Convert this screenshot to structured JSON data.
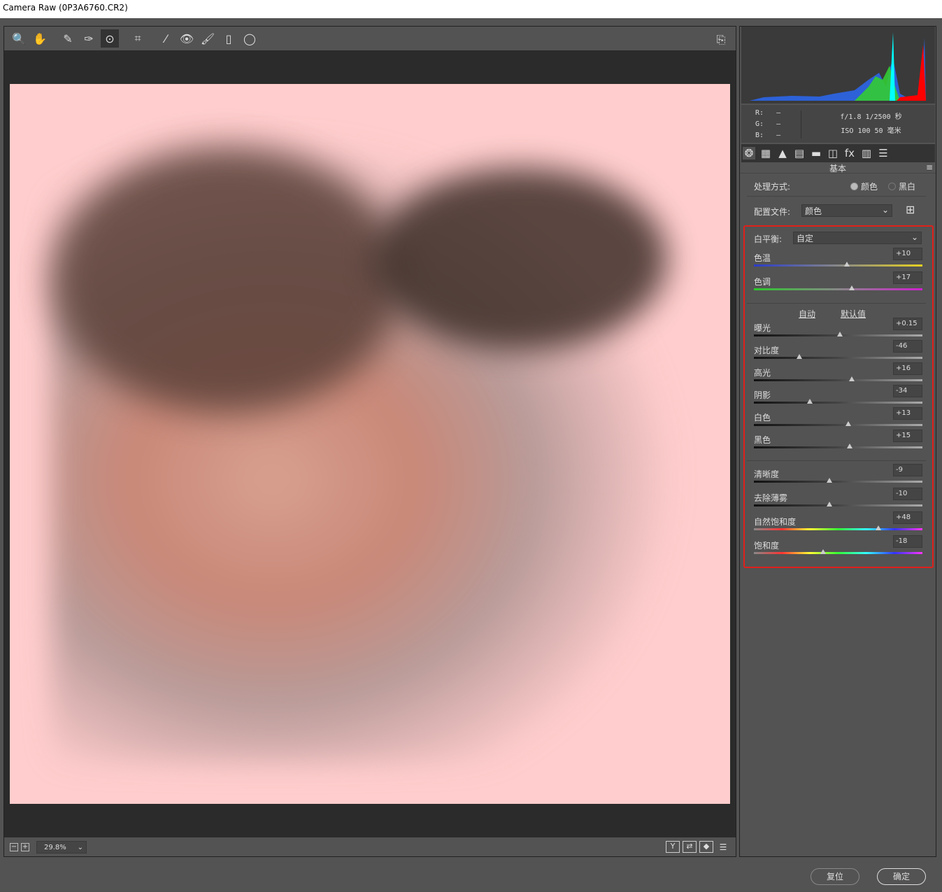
{
  "window": {
    "title": "Camera Raw (0P3A6760.CR2)"
  },
  "toolbar": {
    "tools": [
      {
        "name": "zoom-tool-icon",
        "glyph": "🔍"
      },
      {
        "name": "hand-tool-icon",
        "glyph": "✋"
      },
      {
        "name": "white-balance-tool-icon",
        "glyph": "✎"
      },
      {
        "name": "color-sampler-tool-icon",
        "glyph": "✑"
      },
      {
        "name": "targeted-adjustment-tool-icon",
        "glyph": "⊙",
        "active": true
      },
      {
        "name": "transform-tool-icon",
        "glyph": "⌗"
      },
      {
        "name": "spot-removal-tool-icon",
        "glyph": "⁄"
      },
      {
        "name": "red-eye-tool-icon",
        "glyph": "👁"
      },
      {
        "name": "adjustment-brush-icon",
        "glyph": "🖌"
      },
      {
        "name": "graduated-filter-icon",
        "glyph": "▯"
      },
      {
        "name": "radial-filter-icon",
        "glyph": "◯"
      }
    ],
    "export_icon": "⎘"
  },
  "bottom": {
    "zoom_level": "29.8%",
    "minus": "−",
    "plus": "+",
    "view_buttons": [
      "Y",
      "⇄",
      "◆",
      "☰"
    ]
  },
  "histogram": {
    "r_label": "R:",
    "g_label": "G:",
    "b_label": "B:",
    "r": "—",
    "g": "—",
    "b": "—",
    "aperture_shutter": "f/1.8  1/2500 秒",
    "iso_focal": "ISO 100  50 毫米"
  },
  "tabs": [
    "❂",
    "▦",
    "▲",
    "▤",
    "▬",
    "◫",
    "fx",
    "▥",
    "☰"
  ],
  "panel": {
    "title": "基本",
    "menu_icon": "≡",
    "treatment_label": "处理方式:",
    "treatment_color": "颜色",
    "treatment_bw": "黑白",
    "treatment_selected": "颜色",
    "profile_label": "配置文件:",
    "profile_value": "颜色",
    "browse_icon": "⊞",
    "wb_label": "白平衡:",
    "wb_value": "自定",
    "auto": "自动",
    "default": "默认值",
    "sliders": [
      {
        "label": "色温",
        "value": "+10",
        "pos": 0.55,
        "track": "temp"
      },
      {
        "label": "色调",
        "value": "+17",
        "pos": 0.58,
        "track": "tint"
      },
      {
        "label": "曝光",
        "value": "+0.15",
        "pos": 0.51
      },
      {
        "label": "对比度",
        "value": "-46",
        "pos": 0.27
      },
      {
        "label": "高光",
        "value": "+16",
        "pos": 0.58
      },
      {
        "label": "阴影",
        "value": "-34",
        "pos": 0.33
      },
      {
        "label": "白色",
        "value": "+13",
        "pos": 0.56
      },
      {
        "label": "黑色",
        "value": "+15",
        "pos": 0.57
      },
      {
        "label": "清晰度",
        "value": "-9",
        "pos": 0.45
      },
      {
        "label": "去除薄雾",
        "value": "-10",
        "pos": 0.45
      },
      {
        "label": "自然饱和度",
        "value": "+48",
        "pos": 0.74,
        "track": "sat"
      },
      {
        "label": "饱和度",
        "value": "-18",
        "pos": 0.41,
        "track": "sat"
      }
    ]
  },
  "buttons": {
    "reset": "复位",
    "ok": "确定"
  },
  "colors": {
    "highlight_box": "#e0201a",
    "photo_bg": "#ffcdcd"
  }
}
